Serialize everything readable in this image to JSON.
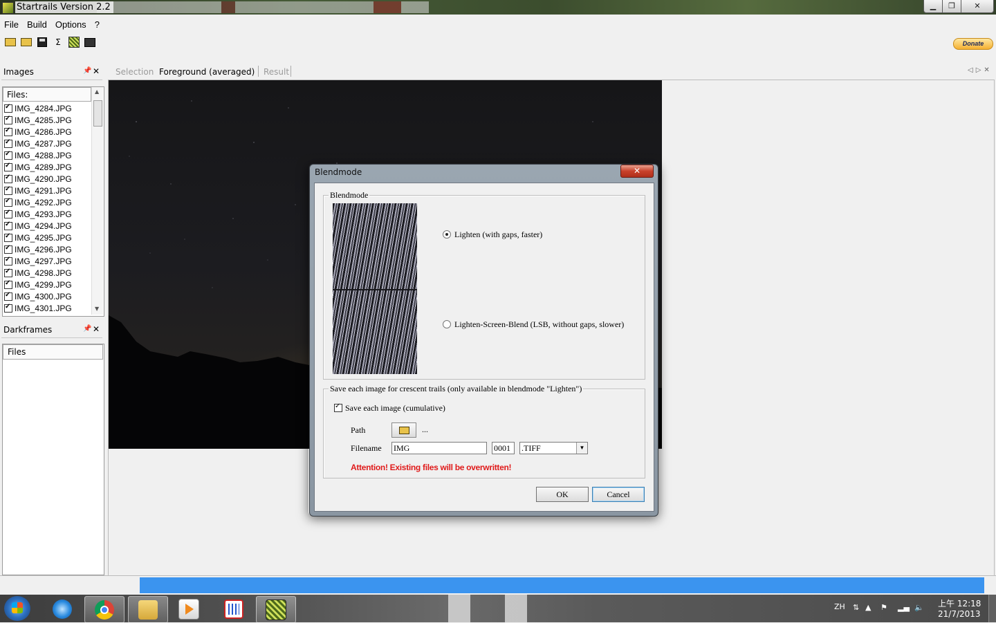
{
  "window": {
    "title": "Startrails Version 2.2",
    "min": "▁",
    "max": "❐",
    "close": "✕"
  },
  "menu": [
    "File",
    "Build",
    "Options",
    "?"
  ],
  "toolbar": {
    "donate_label": "Donate",
    "sum_glyph": "Σ"
  },
  "images_panel": {
    "title": "Images",
    "files_header": "Files:",
    "files": [
      "IMG_4284.JPG",
      "IMG_4285.JPG",
      "IMG_4286.JPG",
      "IMG_4287.JPG",
      "IMG_4288.JPG",
      "IMG_4289.JPG",
      "IMG_4290.JPG",
      "IMG_4291.JPG",
      "IMG_4292.JPG",
      "IMG_4293.JPG",
      "IMG_4294.JPG",
      "IMG_4295.JPG",
      "IMG_4296.JPG",
      "IMG_4297.JPG",
      "IMG_4298.JPG",
      "IMG_4299.JPG",
      "IMG_4300.JPG",
      "IMG_4301.JPG"
    ],
    "all_checked": true
  },
  "darkframes_panel": {
    "title": "Darkframes",
    "files_header": "Files"
  },
  "panel_controls": {
    "pin": "📌",
    "close": "✕"
  },
  "tabs": {
    "selection": "Selection",
    "foreground": "Foreground (averaged)",
    "result": "Result",
    "nav": "◁▷✕"
  },
  "dialog": {
    "title": "Blendmode",
    "close": "✕",
    "blend_legend": "Blendmode",
    "option_lighten": "Lighten (with gaps, faster)",
    "option_lsb": "Lighten-Screen-Blend (LSB, without gaps, slower)",
    "selected_option": "lighten",
    "save_legend": "Save each image for crescent trails (only available in blendmode \"Lighten\")",
    "save_checkbox_label": "Save each image (cumulative)",
    "save_checked": true,
    "path_label": "Path",
    "path_value": "...",
    "filename_label": "Filename",
    "filename_value": "IMG",
    "counter_value": "0001",
    "format_value": ".TIFF",
    "warning": "Attention! Existing files will be overwritten!",
    "ok_label": "OK",
    "cancel_label": "Cancel"
  },
  "progress": {
    "fraction": 1.0
  },
  "taskbar": {
    "lang": "ZH",
    "clock_time": "上午 12:18",
    "clock_date": "21/7/2013",
    "tray_icons": [
      "up-arrow",
      "flag-error",
      "signal",
      "volume"
    ]
  },
  "colors": {
    "progress": "#3b94ef",
    "warning": "#e01b1b",
    "dialog_close": "#c8412b"
  }
}
